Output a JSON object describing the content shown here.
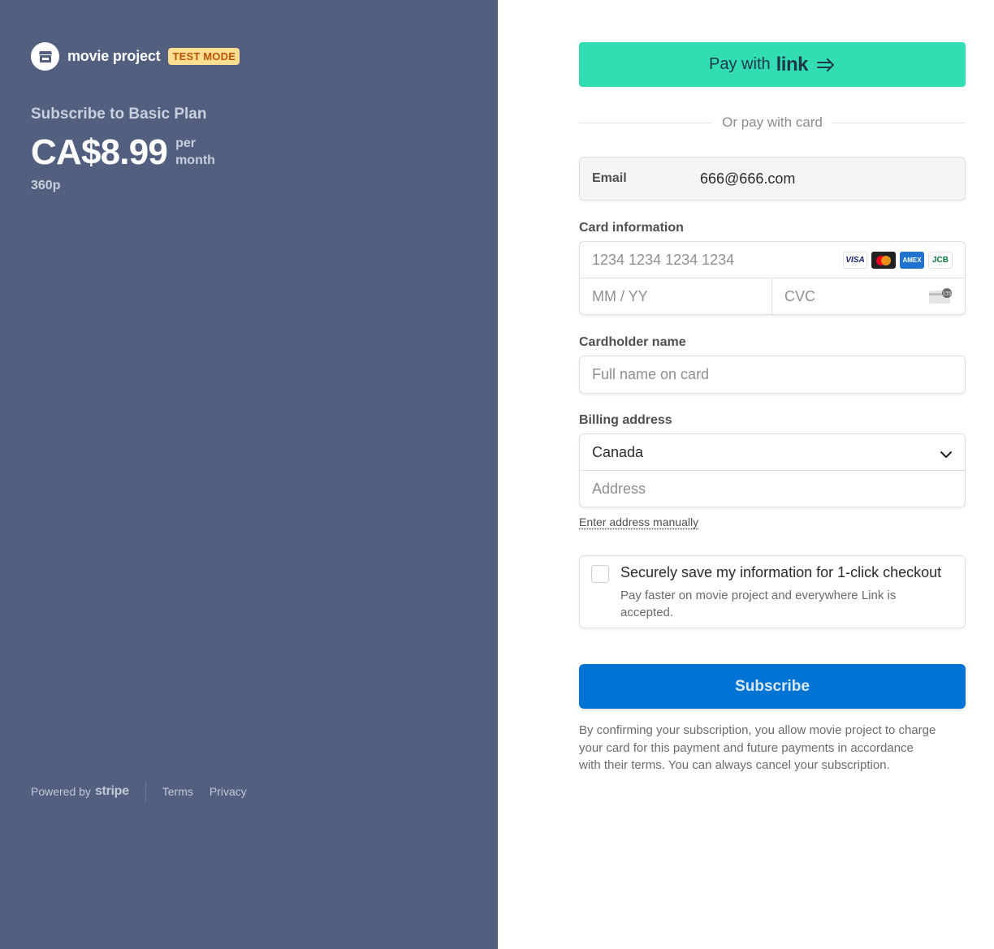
{
  "merchant": {
    "name": "movie project",
    "badge": "TEST MODE",
    "logo_icon": "store-icon"
  },
  "plan": {
    "title": "Subscribe to Basic Plan",
    "price": "CA$8.99",
    "period_line1": "per",
    "period_line2": "month",
    "description": "360p"
  },
  "footer": {
    "powered_by": "Powered by",
    "brand": "stripe",
    "terms": "Terms",
    "privacy": "Privacy"
  },
  "payment": {
    "link_button_prefix": "Pay with",
    "link_button_word": "link",
    "divider_text": "Or pay with card",
    "email_label": "Email",
    "email_value": "666@666.com",
    "card_info_label": "Card information",
    "card_number_placeholder": "1234 1234 1234 1234",
    "card_brands": [
      "VISA",
      "mastercard",
      "AMEX",
      "JCB"
    ],
    "expiry_placeholder": "MM / YY",
    "cvc_placeholder": "CVC",
    "cvc_icon_text": "135",
    "cardholder_label": "Cardholder name",
    "cardholder_placeholder": "Full name on card",
    "billing_label": "Billing address",
    "country_value": "Canada",
    "address_placeholder": "Address",
    "manual_link": "Enter address manually",
    "save_title": "Securely save my information for 1-click checkout",
    "save_description": "Pay faster on movie project and everywhere Link is accepted.",
    "subscribe_label": "Subscribe",
    "terms_text": "By confirming your subscription, you allow movie project to charge your card for this payment and future payments in accordance with their terms. You can always cancel your subscription."
  },
  "colors": {
    "left_panel_bg": "#525f7f",
    "link_green": "#33ddb3",
    "subscribe_blue": "#0074d4",
    "badge_bg": "#ffde92",
    "badge_text": "#bb5504"
  }
}
